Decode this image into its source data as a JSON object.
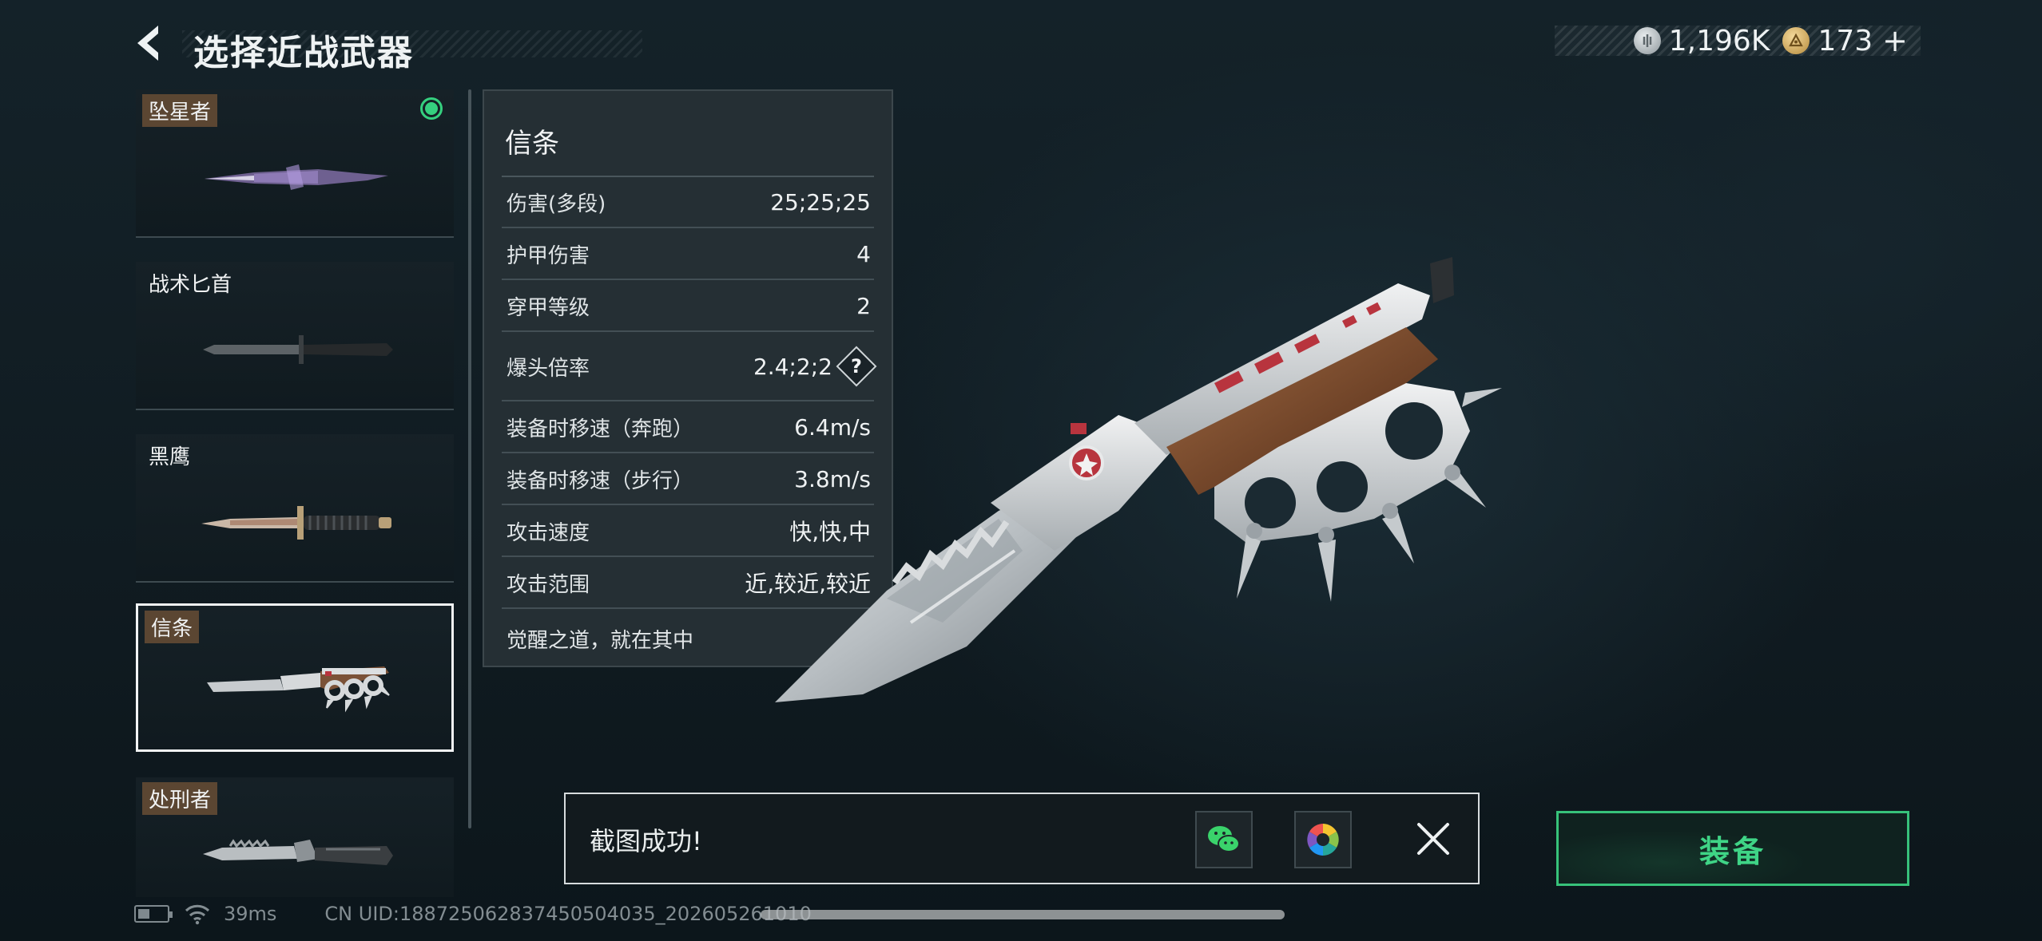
{
  "header": {
    "title": "选择近战武器"
  },
  "currency": {
    "silver_value": "1,196K",
    "gold_value": "173",
    "plus": "+"
  },
  "weapons": [
    {
      "name": "坠星者",
      "tagged": true,
      "equipped": true,
      "selected": false
    },
    {
      "name": "战术匕首",
      "tagged": false,
      "equipped": false,
      "selected": false
    },
    {
      "name": "黑鹰",
      "tagged": false,
      "equipped": false,
      "selected": false
    },
    {
      "name": "信条",
      "tagged": true,
      "equipped": false,
      "selected": true
    },
    {
      "name": "处刑者",
      "tagged": true,
      "equipped": false,
      "selected": false
    }
  ],
  "stats": {
    "name": "信条",
    "rows": [
      {
        "label": "伤害(多段)",
        "value": "25;25;25"
      },
      {
        "label": "护甲伤害",
        "value": "4"
      },
      {
        "label": "穿甲等级",
        "value": "2"
      },
      {
        "label": "爆头倍率",
        "value": "2.4;2;2",
        "help": "?"
      },
      {
        "label": "装备时移速（奔跑）",
        "value": "6.4m/s"
      },
      {
        "label": "装备时移速（步行）",
        "value": "3.8m/s"
      },
      {
        "label": "攻击速度",
        "value": "快,快,中"
      },
      {
        "label": "攻击范围",
        "value": "近,较近,较近"
      }
    ],
    "motto": "觉醒之道，就在其中"
  },
  "toast": {
    "message": "截图成功!"
  },
  "equip_button": {
    "label": "装备"
  },
  "status": {
    "ping": "39ms",
    "uid": "CN UID:188725062837450504035_202605261010"
  },
  "colors": {
    "accent_green": "#37c27a",
    "equipped_green": "#35d07f",
    "tag_brown": "#5b4632"
  }
}
